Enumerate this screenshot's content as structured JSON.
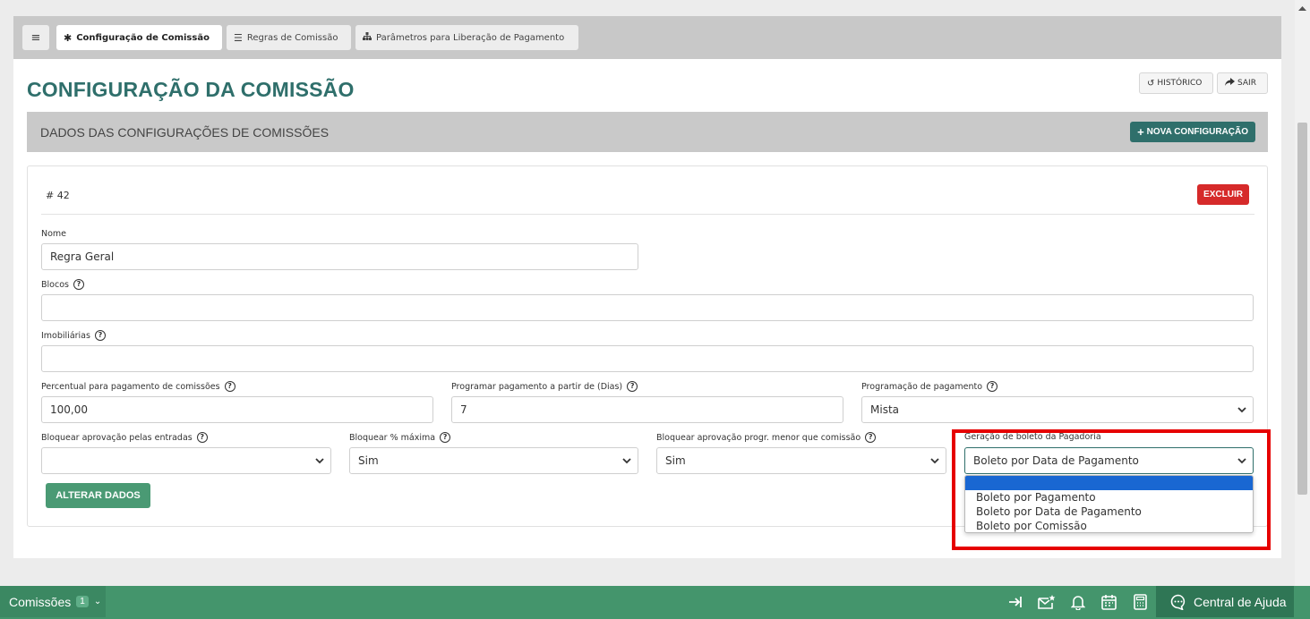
{
  "tabs": [
    {
      "label": "Configuração de Comissão",
      "icon": "gear-icon",
      "active": true
    },
    {
      "label": "Regras de Comissão",
      "icon": "list-icon",
      "active": false
    },
    {
      "label": "Parâmetros para Liberação de Pagamento",
      "icon": "sitemap-icon",
      "active": false
    }
  ],
  "page": {
    "title": "CONFIGURAÇÃO DA COMISSÃO",
    "history_label": "HISTÓRICO",
    "exit_label": "SAIR"
  },
  "section": {
    "title": "DADOS DAS CONFIGURAÇÕES DE COMISSÕES",
    "new_button": "NOVA CONFIGURAÇÃO"
  },
  "config": {
    "id": "# 42",
    "delete_label": "EXCLUIR",
    "fields": {
      "nome": {
        "label": "Nome",
        "value": "Regra Geral"
      },
      "blocos": {
        "label": "Blocos",
        "value": ""
      },
      "imobiliarias": {
        "label": "Imobiliárias",
        "value": ""
      },
      "percentual": {
        "label": "Percentual para pagamento de comissões",
        "value": "100,00"
      },
      "programar": {
        "label": "Programar pagamento a partir de (Dias)",
        "value": "7"
      },
      "programacao": {
        "label": "Programação de pagamento",
        "value": "Mista"
      },
      "bloquear_entradas": {
        "label": "Bloquear aprovação pelas entradas",
        "value": ""
      },
      "bloquear_maxima": {
        "label": "Bloquear % máxima",
        "value": "Sim"
      },
      "bloquear_progr": {
        "label": "Bloquear aprovação progr. menor que comissão",
        "value": "Sim"
      },
      "geracao_boleto": {
        "label": "Geração de boleto da Pagadoria",
        "value": "Boleto por Data de Pagamento"
      }
    },
    "boleto_options": [
      "",
      "Boleto por Pagamento",
      "Boleto por Data de Pagamento",
      "Boleto por Comissão"
    ],
    "save_label": "ALTERAR DADOS"
  },
  "bottombar": {
    "module_label": "Comissões",
    "module_count": "1",
    "help_label": "Central de Ajuda"
  },
  "colors": {
    "accent": "#2f6f6b",
    "save": "#4a9a74",
    "danger": "#d62a2a",
    "bottombar": "#44956c",
    "highlight": "#e60000"
  }
}
